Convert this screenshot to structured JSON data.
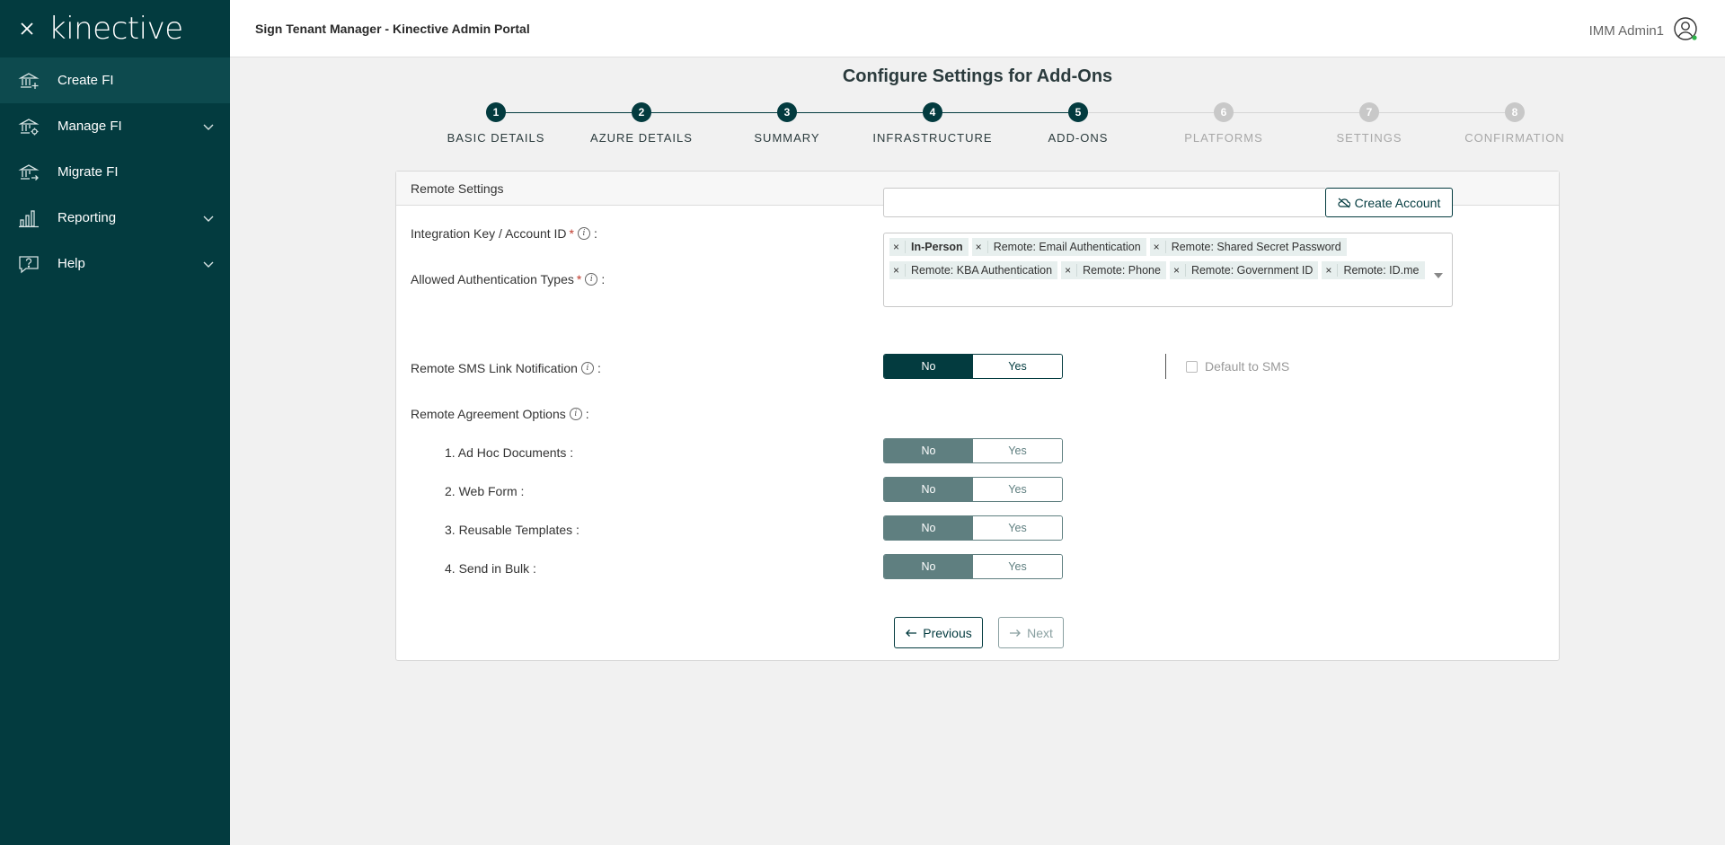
{
  "sidebar": {
    "logo": "kinective",
    "items": [
      {
        "label": "Create FI",
        "icon": "bank-plus-icon",
        "active": true
      },
      {
        "label": "Manage FI",
        "icon": "bank-gear-icon",
        "expandable": true
      },
      {
        "label": "Migrate FI",
        "icon": "bank-arrow-icon"
      },
      {
        "label": "Reporting",
        "icon": "bar-chart-icon",
        "expandable": true
      },
      {
        "label": "Help",
        "icon": "help-bubble-icon",
        "expandable": true
      }
    ]
  },
  "header": {
    "title": "Sign Tenant Manager - Kinective Admin Portal",
    "user": "IMM Admin1"
  },
  "page": {
    "title": "Configure Settings for Add-Ons"
  },
  "steps": [
    {
      "num": "1",
      "label": "BASIC DETAILS",
      "state": "done"
    },
    {
      "num": "2",
      "label": "AZURE DETAILS",
      "state": "done"
    },
    {
      "num": "3",
      "label": "SUMMARY",
      "state": "done"
    },
    {
      "num": "4",
      "label": "INFRASTRUCTURE",
      "state": "done"
    },
    {
      "num": "5",
      "label": "ADD-ONS",
      "state": "current"
    },
    {
      "num": "6",
      "label": "PLATFORMS",
      "state": "pending"
    },
    {
      "num": "7",
      "label": "SETTINGS",
      "state": "pending"
    },
    {
      "num": "8",
      "label": "CONFIRMATION",
      "state": "pending"
    }
  ],
  "card": {
    "title": "Remote Settings",
    "integration_key": {
      "label": "Integration Key / Account ID",
      "required": "*",
      "colon": ":",
      "value": "",
      "button": "Create Account"
    },
    "auth_types": {
      "label": "Allowed Authentication Types",
      "required": "*",
      "colon": ":",
      "remove_glyph": "×",
      "tags": [
        "In-Person",
        "Remote: Email Authentication",
        "Remote: Shared Secret Password",
        "Remote: KBA Authentication",
        "Remote: Phone",
        "Remote: Government ID",
        "Remote: ID.me"
      ]
    },
    "sms": {
      "label": "Remote SMS Link Notification",
      "colon": ":",
      "no": "No",
      "yes": "Yes",
      "selected": "No",
      "default_label": "Default to SMS",
      "default_checked": false
    },
    "agreement": {
      "label": "Remote Agreement Options",
      "colon": ":",
      "options": [
        {
          "label": "1. Ad Hoc Documents :",
          "no": "No",
          "yes": "Yes",
          "selected": "No"
        },
        {
          "label": "2. Web Form :",
          "no": "No",
          "yes": "Yes",
          "selected": "No"
        },
        {
          "label": "3. Reusable Templates :",
          "no": "No",
          "yes": "Yes",
          "selected": "No"
        },
        {
          "label": "4. Send in Bulk :",
          "no": "No",
          "yes": "Yes",
          "selected": "No"
        }
      ]
    },
    "buttons": {
      "previous": "Previous",
      "next": "Next"
    }
  },
  "colors": {
    "primary": "#033b3f",
    "muted_toggle": "#5f7f80",
    "pending": "#c8c8c8",
    "tag_bg": "#e7efee",
    "required": "#c0392b"
  }
}
